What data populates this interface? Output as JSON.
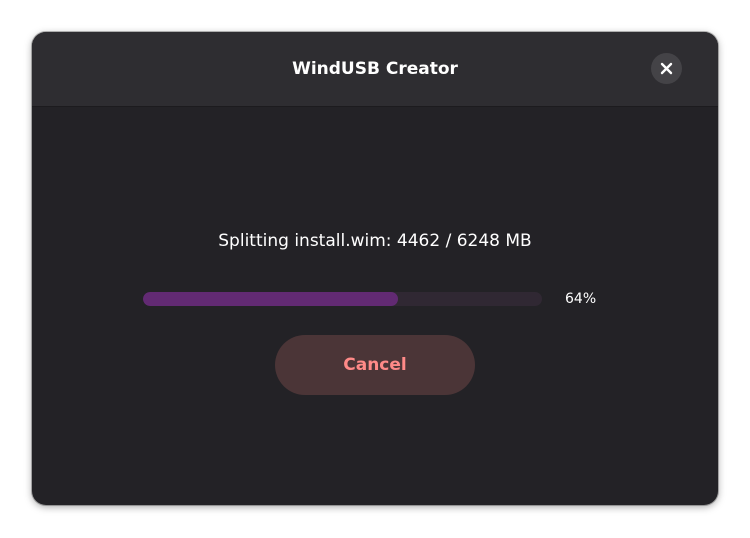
{
  "window": {
    "title": "WindUSB Creator",
    "close_icon": "close-icon"
  },
  "progress": {
    "status_text": "Splitting install.wim: 4462 / 6248 MB",
    "fraction": 0.64,
    "percent_label": "64%"
  },
  "actions": {
    "cancel_label": "Cancel"
  },
  "colors": {
    "accent_fill": "#622a73",
    "destructive_text": "#ff8a88"
  }
}
